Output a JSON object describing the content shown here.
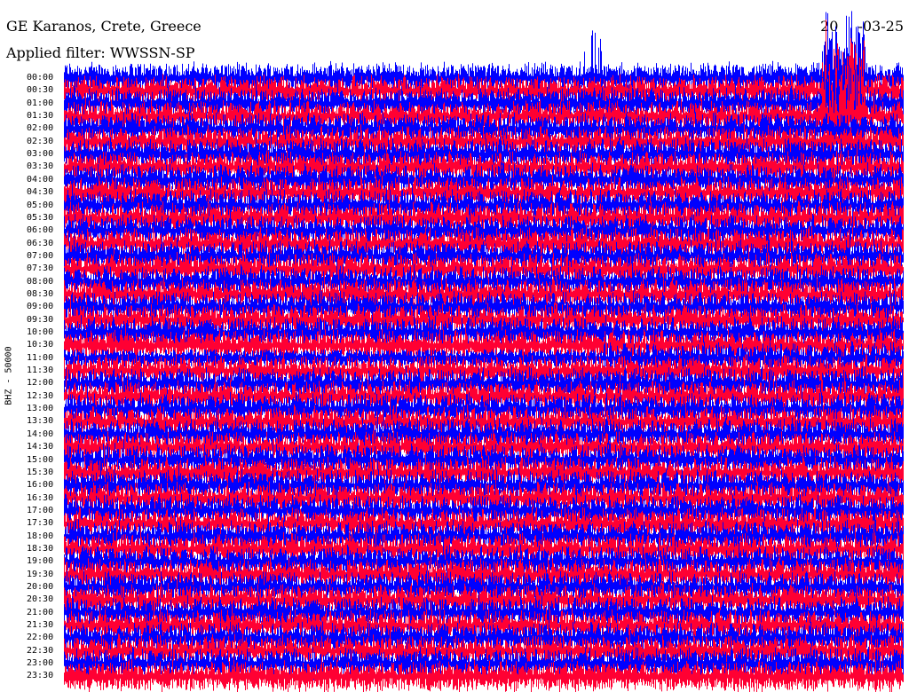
{
  "header": {
    "station": "GE Karanos, Crete, Greece",
    "filter": "Applied filter: WWSSN-SP",
    "date_visible_start": "20",
    "date_visible_end": "03-25"
  },
  "chart_data": {
    "type": "line",
    "title": "GE Karanos, Crete, Greece",
    "subtitle": "Applied filter: WWSSN-SP",
    "ylabel": "BHZ - 50000",
    "row_labels": [
      "00:00",
      "00:30",
      "01:00",
      "01:30",
      "02:00",
      "02:30",
      "03:00",
      "03:30",
      "04:00",
      "04:30",
      "05:00",
      "05:30",
      "06:00",
      "06:30",
      "07:00",
      "07:30",
      "08:00",
      "08:30",
      "09:00",
      "09:30",
      "10:00",
      "10:30",
      "11:00",
      "11:30",
      "12:00",
      "12:30",
      "13:00",
      "13:30",
      "14:00",
      "14:30",
      "15:00",
      "15:30",
      "16:00",
      "16:30",
      "17:00",
      "17:30",
      "18:00",
      "18:30",
      "19:00",
      "19:30",
      "20:00",
      "20:30",
      "21:00",
      "21:30",
      "22:00",
      "22:30",
      "23:00",
      "23:30"
    ],
    "row_minutes": 30,
    "colors": [
      "#0000ff",
      "#ff0033"
    ],
    "grid": false
  }
}
